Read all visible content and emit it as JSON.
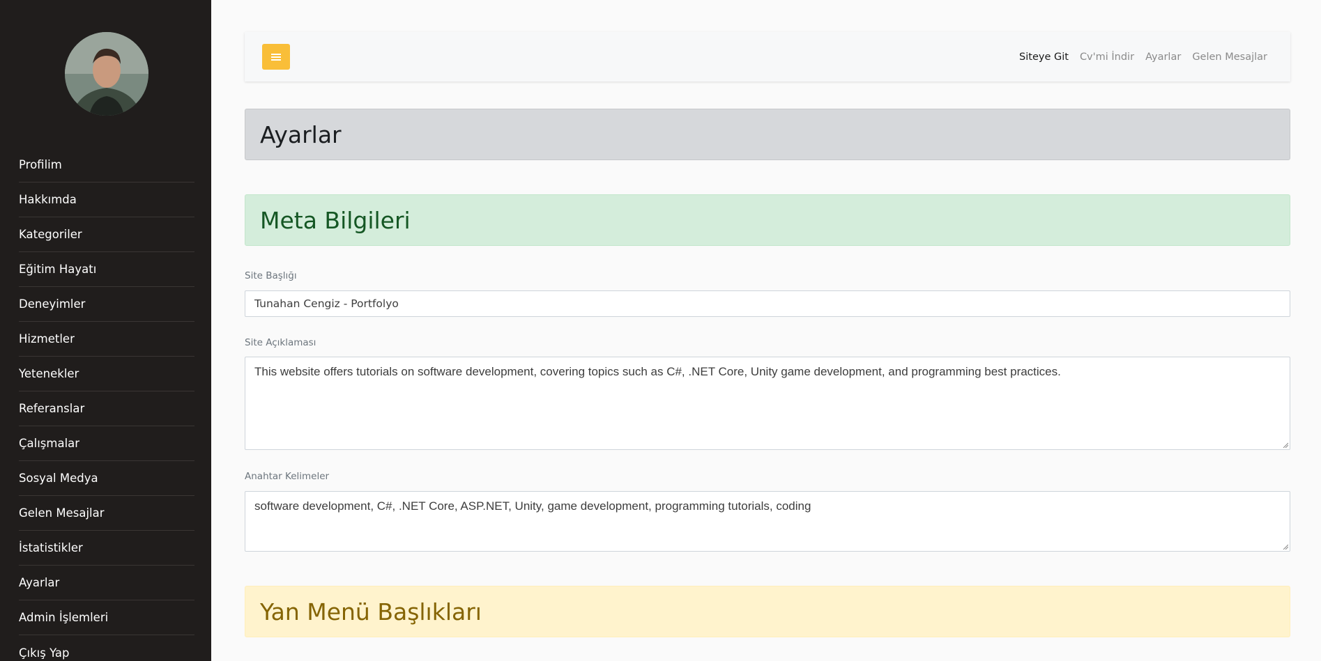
{
  "sidebar": {
    "items": [
      {
        "label": "Profilim"
      },
      {
        "label": "Hakkımda"
      },
      {
        "label": "Kategoriler"
      },
      {
        "label": "Eğitim Hayatı"
      },
      {
        "label": "Deneyimler"
      },
      {
        "label": "Hizmetler"
      },
      {
        "label": "Yetenekler"
      },
      {
        "label": "Referanslar"
      },
      {
        "label": "Çalışmalar"
      },
      {
        "label": "Sosyal Medya"
      },
      {
        "label": "Gelen Mesajlar"
      },
      {
        "label": "İstatistikler"
      },
      {
        "label": "Ayarlar"
      },
      {
        "label": "Admin İşlemleri"
      },
      {
        "label": "Çıkış Yap"
      }
    ]
  },
  "topbar": {
    "menu_icon": "hamburger-icon",
    "links": [
      {
        "label": "Siteye Git"
      },
      {
        "label": "Cv'mi İndir"
      },
      {
        "label": "Ayarlar"
      },
      {
        "label": "Gelen Mesajlar"
      }
    ]
  },
  "page": {
    "title": "Ayarlar",
    "meta_section": "Meta Bilgileri",
    "side_section": "Yan Menü Başlıkları"
  },
  "form": {
    "site_title_label": "Site Başlığı",
    "site_title_value": "Tunahan Cengiz - Portfolyo",
    "site_desc_label": "Site Açıklaması",
    "site_desc_value": "This website offers tutorials on software development, covering topics such as C#, .NET Core, Unity game development, and programming best practices.",
    "keywords_label": "Anahtar Kelimeler",
    "keywords_value": "software development, C#, .NET Core, ASP.NET, Unity, game development, programming tutorials, coding"
  },
  "colors": {
    "sidebar_bg": "#201d1c",
    "accent": "#f9be38",
    "success_bg": "#d4eddb",
    "warning_bg": "#fff3cd",
    "secondary_bg": "#d6d8db"
  }
}
